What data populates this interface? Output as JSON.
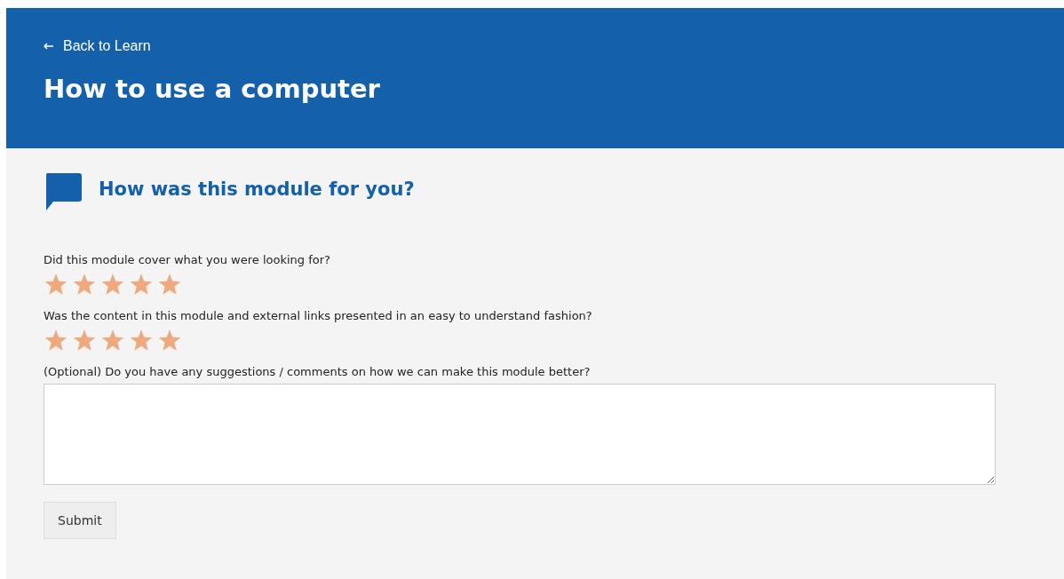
{
  "header": {
    "back_link": "Back to Learn",
    "title": "How to use a computer"
  },
  "feedback": {
    "heading": "How was this module for you?",
    "questions": [
      {
        "kind": "rating",
        "label": "Did this module cover what you were looking for?",
        "stars": 5
      },
      {
        "kind": "rating",
        "label": "Was the content in this module and external links presented in an easy to understand fashion?",
        "stars": 5
      },
      {
        "kind": "text",
        "label": "(Optional) Do you have any suggestions / comments on how we can make this module better?"
      }
    ],
    "submit": "Submit"
  }
}
